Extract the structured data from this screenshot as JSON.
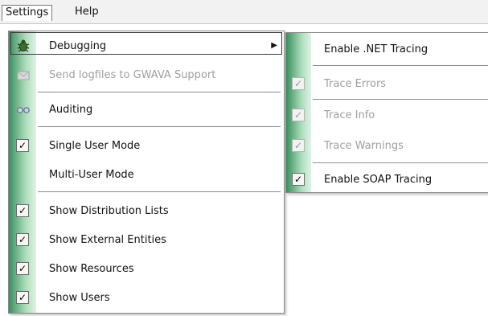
{
  "menubar": {
    "settings_label": "Settings",
    "help_label": "Help"
  },
  "settings_menu": {
    "items": [
      {
        "label": "Debugging",
        "icon": "bug-icon",
        "submenu": true,
        "enabled": true
      },
      {
        "label": "Send logfiles to GWAVA Support",
        "icon": "envelope-icon",
        "enabled": false
      },
      {
        "label": "Auditing",
        "icon": "glasses-icon",
        "enabled": true
      },
      {
        "label": "Single User Mode",
        "checked": true,
        "enabled": true
      },
      {
        "label": "Multi-User Mode",
        "checked": false,
        "enabled": true
      },
      {
        "label": "Show Distribution Lists",
        "checked": true,
        "enabled": true
      },
      {
        "label": "Show External Entities",
        "checked": true,
        "enabled": true
      },
      {
        "label": "Show Resources",
        "checked": true,
        "enabled": true
      },
      {
        "label": "Show Users",
        "checked": true,
        "enabled": true
      }
    ]
  },
  "debugging_submenu": {
    "items": [
      {
        "label": "Enable .NET Tracing",
        "checked": false,
        "enabled": true
      },
      {
        "label": "Trace Errors",
        "checked": true,
        "enabled": false
      },
      {
        "label": "Trace Info",
        "checked": true,
        "enabled": false
      },
      {
        "label": "Trace Warnings",
        "checked": true,
        "enabled": false
      },
      {
        "label": "Enable SOAP Tracing",
        "checked": true,
        "enabled": true
      }
    ]
  },
  "colors": {
    "gutter_dark": "#3a8f5e",
    "gutter_light": "#e0f3e6",
    "disabled_text": "#a0a0a0"
  }
}
